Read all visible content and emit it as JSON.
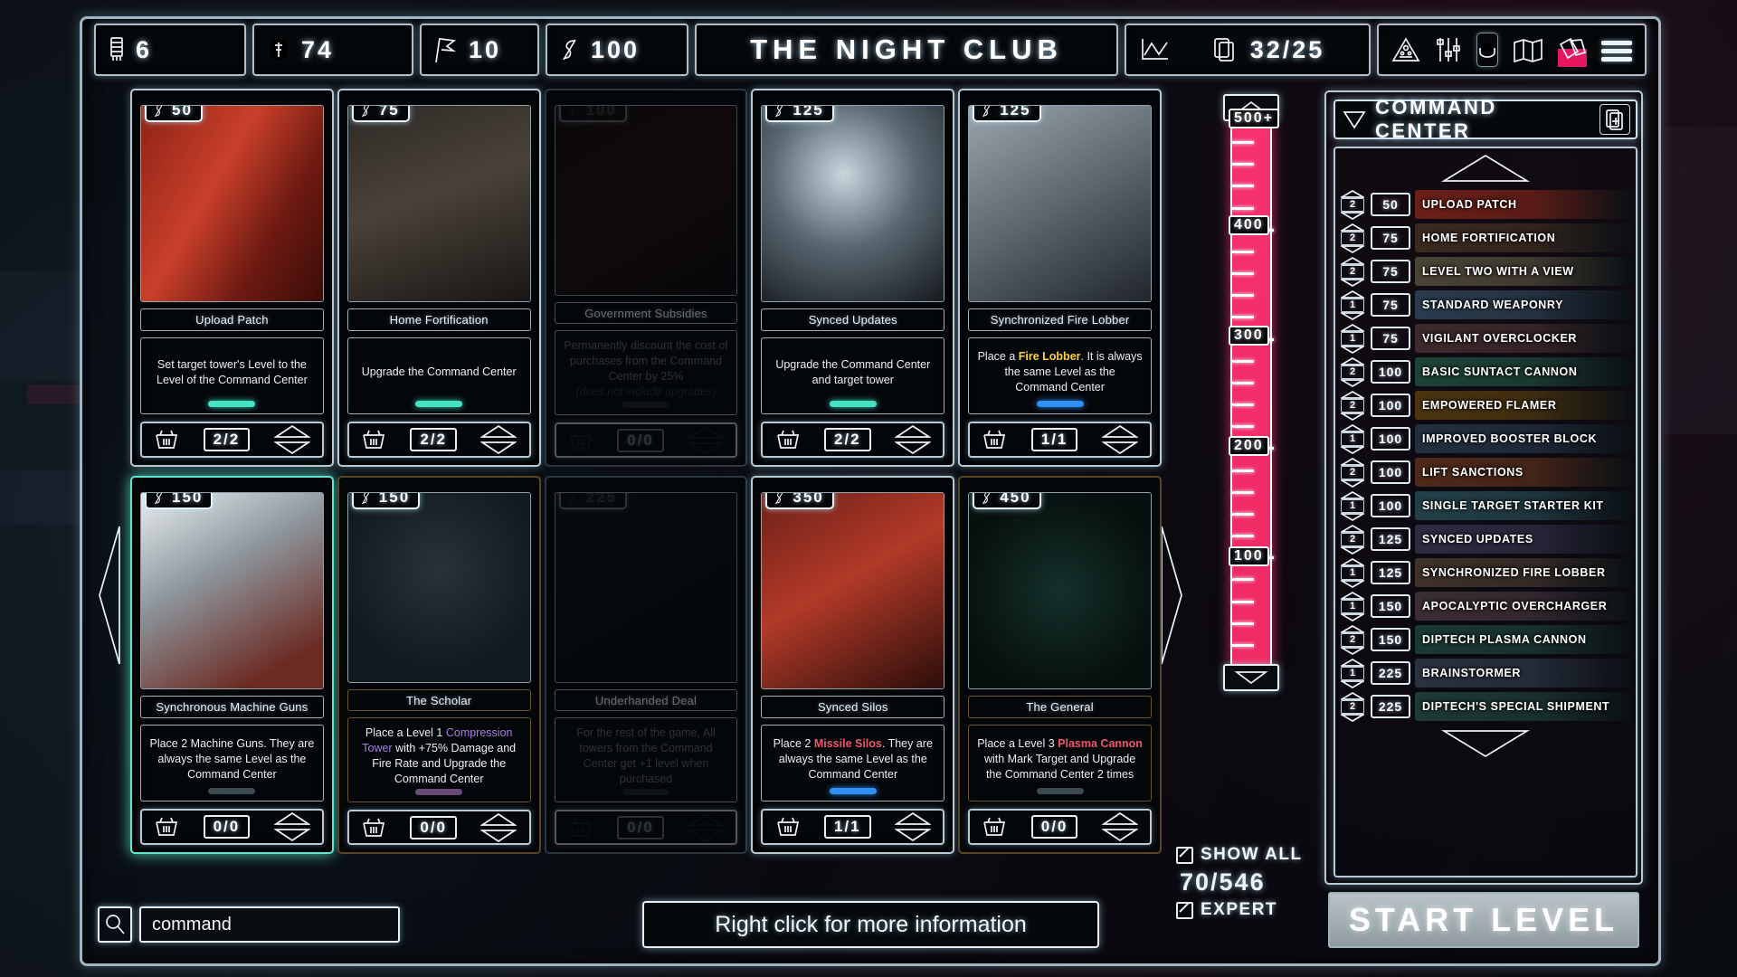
{
  "topbar": {
    "level": "6",
    "coins": "74",
    "flags": "10",
    "currency": "100",
    "title": "THE NIGHT CLUB",
    "cards": "32/25",
    "icons": [
      "level-icon",
      "coin-icon",
      "flag-icon",
      "currency-icon",
      "graph-icon",
      "cards-icon",
      "warning-icon",
      "sliders-icon",
      "disc-icon",
      "map-icon",
      "deck-icon",
      "menu-icon"
    ]
  },
  "cards": [
    {
      "cost": "50",
      "name": "Upload Patch",
      "desc": "Set target tower's Level to the Level of the Command Center",
      "count": "2/2",
      "bar": "teal",
      "state": "normal",
      "art": "red-industrial"
    },
    {
      "cost": "75",
      "name": "Home Fortification",
      "desc": "Upgrade the Command Center",
      "count": "2/2",
      "bar": "teal",
      "state": "normal",
      "art": "dark-tire"
    },
    {
      "cost": "100",
      "name": "Government Subsidies",
      "desc": "Permanently discount the cost of purchases from the Command Center by 25%",
      "desc_italic": "(does not include upgrades)",
      "count": "0/0",
      "bar": "grey",
      "state": "dim",
      "art": "dark-vehicle"
    },
    {
      "cost": "125",
      "name": "Synced Updates",
      "desc": "Upgrade the Command Center and target tower",
      "count": "2/2",
      "bar": "teal",
      "state": "normal",
      "art": "sphere-caution"
    },
    {
      "cost": "125",
      "name": "Synchronized Fire Lobber",
      "desc_pre": "Place a ",
      "desc_hl": "Fire Lobber",
      "desc_hl_color": "gold",
      "desc_post": ". It is always the same Level as the Command Center",
      "count": "1/1",
      "bar": "blue",
      "state": "normal",
      "art": "metal-turret"
    },
    {
      "cost": "150",
      "name": "Synchronous Machine Guns",
      "desc": "Place 2 Machine Guns. They are always the same Level as the Command Center",
      "count": "0/0",
      "bar": "grey",
      "state": "selected",
      "art": "bright-turrets"
    },
    {
      "cost": "150",
      "name": "The Scholar",
      "desc_pre": "Place a Level 1 ",
      "desc_hl": "Compression Tower",
      "desc_hl_color": "purple",
      "desc_post": " with +75% Damage and Fire Rate and Upgrade the Command Center",
      "count": "0/0",
      "bar": "purple",
      "state": "dim-gold",
      "art": "statue"
    },
    {
      "cost": "225",
      "name": "Underhanded Deal",
      "desc": "For the rest of the game, All towers from the Command Center get +1 level when purchased",
      "count": "0/0",
      "bar": "grey",
      "state": "dim",
      "art": "dark-rubble"
    },
    {
      "cost": "350",
      "name": "Synced Silos",
      "desc_pre": "Place 2 ",
      "desc_hl": "Missile Silos",
      "desc_hl_color": "red",
      "desc_post": ". They are always the same Level as the Command Center",
      "count": "1/1",
      "bar": "blue",
      "state": "normal",
      "art": "red-silos"
    },
    {
      "cost": "450",
      "name": "The General",
      "desc_pre": "Place a Level 3 ",
      "desc_hl": "Plasma Cannon",
      "desc_hl_color": "red",
      "desc_post": " with Mark Target and Upgrade the Command Center 2 times",
      "count": "0/0",
      "bar": "grey",
      "state": "dim-gold",
      "art": "dark-green"
    }
  ],
  "scale": {
    "cap_label": "500+",
    "labels": [
      "400",
      "300",
      "200",
      "100"
    ]
  },
  "command_center": {
    "title": "COMMAND CENTER",
    "add_icon": "add-card-icon",
    "scroll_up_icon": "scroll-up-arrow",
    "scroll_down_icon": "scroll-down-arrow",
    "items": [
      {
        "qty": "2",
        "price": "50",
        "name": "UPLOAD PATCH",
        "thumb": "#6b2018"
      },
      {
        "qty": "2",
        "price": "75",
        "name": "HOME FORTIFICATION",
        "thumb": "#3a2a20"
      },
      {
        "qty": "2",
        "price": "75",
        "name": "LEVEL TWO WITH A VIEW",
        "thumb": "#4a4436"
      },
      {
        "qty": "1",
        "price": "75",
        "name": "STANDARD WEAPONRY",
        "thumb": "#2b3c4e"
      },
      {
        "qty": "1",
        "price": "75",
        "name": "VIGILANT OVERCLOCKER",
        "thumb": "#3c2a2c"
      },
      {
        "qty": "2",
        "price": "100",
        "name": "BASIC SUNTACT CANNON",
        "thumb": "#1d4438"
      },
      {
        "qty": "2",
        "price": "100",
        "name": "EMPOWERED FLAMER",
        "thumb": "#4a3510"
      },
      {
        "qty": "1",
        "price": "100",
        "name": "IMPROVED BOOSTER BLOCK",
        "thumb": "#22303f"
      },
      {
        "qty": "2",
        "price": "100",
        "name": "LIFT SANCTIONS",
        "thumb": "#4f2a1a"
      },
      {
        "qty": "1",
        "price": "100",
        "name": "SINGLE TARGET STARTER KIT",
        "thumb": "#234048"
      },
      {
        "qty": "2",
        "price": "125",
        "name": "SYNCED UPDATES",
        "thumb": "#2e2b42"
      },
      {
        "qty": "1",
        "price": "125",
        "name": "SYNCHRONIZED FIRE LOBBER",
        "thumb": "#3e322a"
      },
      {
        "qty": "1",
        "price": "150",
        "name": "APOCALYPTIC OVERCHARGER",
        "thumb": "#3a2e34"
      },
      {
        "qty": "2",
        "price": "150",
        "name": "DIPTECH PLASMA CANNON",
        "thumb": "#1b3a33"
      },
      {
        "qty": "1",
        "price": "225",
        "name": "BRAINSTORMER",
        "thumb": "#2a3240"
      },
      {
        "qty": "2",
        "price": "225",
        "name": "DIPTECH'S SPECIAL SHIPMENT",
        "thumb": "#1d3a34"
      }
    ]
  },
  "bottom": {
    "search_value": "command",
    "search_placeholder": "search",
    "info_text": "Right click for more information",
    "show_all_label": "SHOW ALL",
    "expert_label": "EXPERT",
    "ratio": "70/546",
    "start_label": "START LEVEL"
  },
  "colors": {
    "accent_teal": "#45e3c4",
    "accent_pink": "#f5316f",
    "accent_blue": "#2f8ff5",
    "frame": "#b9cad4",
    "gold": "#ffd23c"
  }
}
